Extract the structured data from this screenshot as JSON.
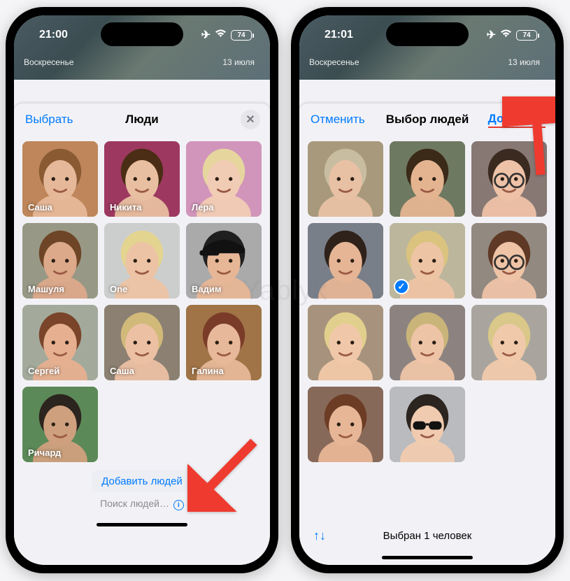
{
  "watermark": "Yablyk",
  "phone_left": {
    "status": {
      "time": "21:00",
      "battery": "74",
      "airplane": "✈︎",
      "wifi": "􀙇"
    },
    "bg": {
      "day": "Воскресенье",
      "date": "13 июля"
    },
    "nav": {
      "select": "Выбрать",
      "title": "Люди"
    },
    "people": [
      {
        "name": "Саша",
        "g": [
          "#d9a97d",
          "#a86a3e"
        ],
        "skin": "#e6b89a",
        "hair": "#8a5a33"
      },
      {
        "name": "Никита",
        "g": [
          "#c25a7f",
          "#7f1e47"
        ],
        "skin": "#e8bfa0",
        "hair": "#4a2d14"
      },
      {
        "name": "Лера",
        "g": [
          "#e9bcdd",
          "#bd759e"
        ],
        "skin": "#f1ccb4",
        "hair": "#e6d69e"
      },
      {
        "name": "Машуля",
        "g": [
          "#b9b9a5",
          "#7d7d6e"
        ],
        "skin": "#dca98b",
        "hair": "#6e4527"
      },
      {
        "name": "One",
        "g": [
          "#e4e6e3",
          "#b8babb"
        ],
        "skin": "#ecc3a4",
        "hair": "#e3d490"
      },
      {
        "name": "Вадим",
        "g": [
          "#cfcfcf",
          "#8c8c8c"
        ],
        "skin": "#e7b697",
        "hair": "#1f1f1f",
        "cap": true
      },
      {
        "name": "Сергей",
        "g": [
          "#c9cfc1",
          "#838c7b"
        ],
        "skin": "#e6b090",
        "hair": "#7a442a"
      },
      {
        "name": "Саша",
        "g": [
          "#b0a392",
          "#6e6558"
        ],
        "skin": "#ecc0a3",
        "hair": "#d1b97a"
      },
      {
        "name": "Галина",
        "g": [
          "#c79763",
          "#7f5831"
        ],
        "skin": "#e7b899",
        "hair": "#7a3c28"
      },
      {
        "name": "Ричард",
        "g": [
          "#7ea873",
          "#3f6f42"
        ],
        "skin": "#cfa07e",
        "hair": "#2c241e"
      }
    ],
    "add_people": "Добавить людей",
    "search_hint": "Поиск людей…"
  },
  "phone_right": {
    "status": {
      "time": "21:01",
      "battery": "74"
    },
    "bg": {
      "day": "Воскресенье",
      "date": "13 июля"
    },
    "nav": {
      "cancel": "Отменить",
      "title": "Выбор людей",
      "add": "Добавить"
    },
    "faces": [
      {
        "g": [
          "#c7b99c",
          "#8e7f62"
        ],
        "skin": "#e8c1a4",
        "hair": "#c8bca1"
      },
      {
        "g": [
          "#8f9a7f",
          "#545e49"
        ],
        "skin": "#e4b491",
        "hair": "#3b2a18"
      },
      {
        "g": [
          "#a89a95",
          "#6c5d59"
        ],
        "skin": "#eec2a7",
        "hair": "#3a2a20",
        "glasses": true
      },
      {
        "g": [
          "#9aa1aa",
          "#5d646d"
        ],
        "skin": "#e6b596",
        "hair": "#2f221a"
      },
      {
        "g": [
          "#d7d2b9",
          "#a59f86"
        ],
        "skin": "#edc4a4",
        "hair": "#d9c37e",
        "selected": true
      },
      {
        "g": [
          "#b9afa7",
          "#736a62"
        ],
        "skin": "#eec3a6",
        "hair": "#5f3926",
        "glasses": true
      },
      {
        "g": [
          "#cbb7a1",
          "#8a7660"
        ],
        "skin": "#f0c8a9",
        "hair": "#e1cf8d"
      },
      {
        "g": [
          "#b2a9a6",
          "#6e6462"
        ],
        "skin": "#eec4a6",
        "hair": "#c9b47a"
      },
      {
        "g": [
          "#cfcac4",
          "#8b8680"
        ],
        "skin": "#f0c9ab",
        "hair": "#d9c889"
      },
      {
        "g": [
          "#a88b7b",
          "#6b4e3e"
        ],
        "skin": "#e7b697",
        "hair": "#6d3c24"
      },
      {
        "g": [
          "#d9dadd",
          "#a1a3a6"
        ],
        "skin": "#f0cbaf",
        "hair": "#2c241e",
        "sunglasses": true
      }
    ],
    "selected_text": "Выбран 1 человек"
  }
}
